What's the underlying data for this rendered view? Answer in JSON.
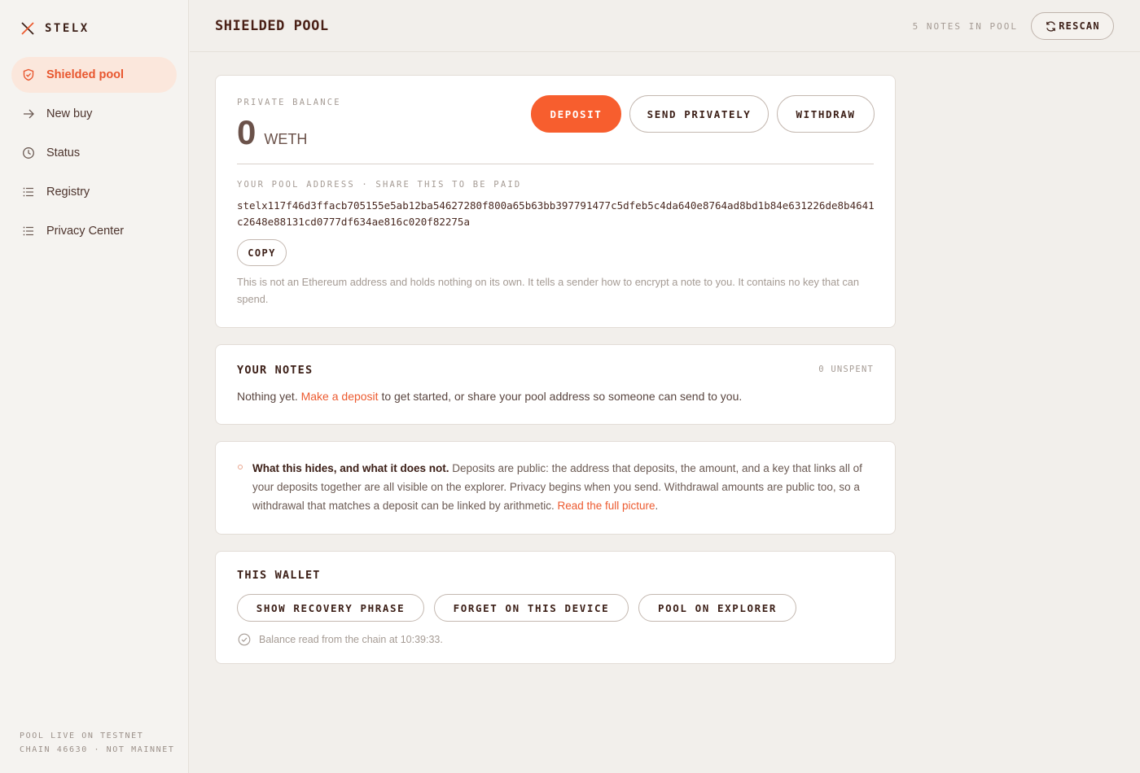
{
  "brand": {
    "name": "STELX",
    "logo_icon": "x-logo-icon"
  },
  "sidebar": {
    "items": [
      {
        "label": "Shielded pool",
        "icon": "shield-icon",
        "active": true
      },
      {
        "label": "New buy",
        "icon": "arrow-right-icon"
      },
      {
        "label": "Status",
        "icon": "clock-icon"
      },
      {
        "label": "Registry",
        "icon": "list-icon"
      },
      {
        "label": "Privacy Center",
        "icon": "list-icon"
      }
    ],
    "footer": {
      "line1": "POOL LIVE ON TESTNET",
      "line2": "CHAIN 46630 · NOT MAINNET"
    }
  },
  "header": {
    "title": "SHIELDED POOL",
    "notes_count": "5 NOTES IN POOL",
    "rescan_label": "RESCAN"
  },
  "balance": {
    "label": "PRIVATE BALANCE",
    "amount": "0",
    "unit": "WETH",
    "deposit_label": "DEPOSIT",
    "send_label": "SEND PRIVATELY",
    "withdraw_label": "WITHDRAW",
    "address_label": "YOUR POOL ADDRESS · SHARE THIS TO BE PAID",
    "address": "stelx117f46d3ffacb705155e5ab12ba54627280f800a65b63bb397791477c5dfeb5c4da640e8764ad8bd1b84e631226de8b4641c2648e88131cd0777df634ae816c020f82275a",
    "copy_label": "COPY",
    "address_note": "This is not an Ethereum address and holds nothing on its own. It tells a sender how to encrypt a note to you. It contains no key that can spend."
  },
  "notes": {
    "title": "YOUR NOTES",
    "unspent": "0 UNSPENT",
    "empty_prefix": "Nothing yet.",
    "empty_link": "Make a deposit",
    "empty_suffix": "to get started, or share your pool address so someone can send to you."
  },
  "privacy": {
    "bold": "What this hides, and what it does not.",
    "body": "Deposits are public: the address that deposits, the amount, and a key that links all of your deposits together are all visible on the explorer. Privacy begins when you send. Withdrawal amounts are public too, so a withdrawal that matches a deposit can be linked by arithmetic.",
    "link": "Read the full picture",
    "end": "."
  },
  "wallet": {
    "title": "THIS WALLET",
    "recovery_label": "SHOW RECOVERY PHRASE",
    "forget_label": "FORGET ON THIS DEVICE",
    "explorer_label": "POOL ON EXPLORER",
    "status": "Balance read from the chain at 10:39:33."
  },
  "colors": {
    "accent": "#f75e2e",
    "background": "#f2efeb",
    "text": "#3d2018"
  }
}
